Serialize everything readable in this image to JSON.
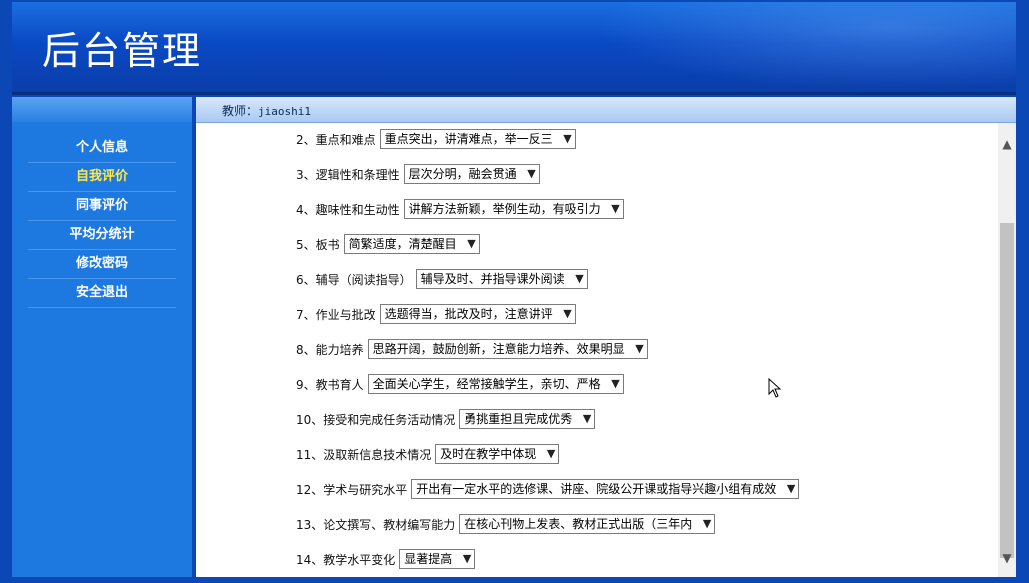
{
  "app": {
    "title": "后台管理"
  },
  "topbar": {
    "teacher_label": "教师：",
    "username": "jiaoshi1"
  },
  "sidebar": {
    "items": [
      {
        "label": "个人信息",
        "active": false
      },
      {
        "label": "自我评价",
        "active": true
      },
      {
        "label": "同事评价",
        "active": false
      },
      {
        "label": "平均分统计",
        "active": false
      },
      {
        "label": "修改密码",
        "active": false
      },
      {
        "label": "安全退出",
        "active": false
      }
    ]
  },
  "form": {
    "rows": [
      {
        "label": "2、重点和难点",
        "value": "重点突出，讲清难点，举一反三"
      },
      {
        "label": "3、逻辑性和条理性",
        "value": "层次分明，融会贯通"
      },
      {
        "label": "4、趣味性和生动性",
        "value": "讲解方法新颖，举例生动，有吸引力"
      },
      {
        "label": "5、板书",
        "value": "简繁适度，清楚醒目"
      },
      {
        "label": "6、辅导（阅读指导）",
        "value": "辅导及时、并指导课外阅读"
      },
      {
        "label": "7、作业与批改",
        "value": "选题得当，批改及时，注意讲评"
      },
      {
        "label": "8、能力培养",
        "value": "思路开阔，鼓励创新，注意能力培养、效果明显"
      },
      {
        "label": "9、教书育人",
        "value": "全面关心学生，经常接触学生，亲切、严格"
      },
      {
        "label": "10、接受和完成任务活动情况",
        "value": "勇挑重担且完成优秀"
      },
      {
        "label": "11、汲取新信息技术情况",
        "value": "及时在教学中体现"
      },
      {
        "label": "12、学术与研究水平",
        "value": "开出有一定水平的选修课、讲座、院级公开课或指导兴趣小组有成效"
      },
      {
        "label": "13、论文撰写、教材编写能力",
        "value": "在核心刊物上发表、教材正式出版（三年内"
      },
      {
        "label": "14、教学水平变化",
        "value": "显著提高"
      }
    ]
  }
}
